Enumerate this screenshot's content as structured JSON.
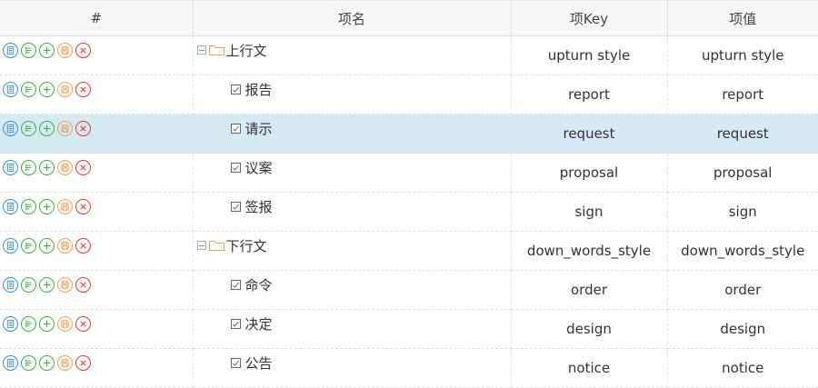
{
  "table": {
    "headers": [
      "#",
      "项名",
      "项Key",
      "项值"
    ],
    "rows": [
      {
        "level": "parent",
        "name": "上行文",
        "key": "upturn style",
        "value": "upturn style",
        "selected": false
      },
      {
        "level": "child",
        "name": "报告",
        "key": "report",
        "value": "report",
        "selected": false
      },
      {
        "level": "child",
        "name": "请示",
        "key": "request",
        "value": "request",
        "selected": true
      },
      {
        "level": "child",
        "name": "议案",
        "key": "proposal",
        "value": "proposal",
        "selected": false
      },
      {
        "level": "child",
        "name": "签报",
        "key": "sign",
        "value": "sign",
        "selected": false
      },
      {
        "level": "parent",
        "name": "下行文",
        "key": "down_words_style",
        "value": "down_words_style",
        "selected": false
      },
      {
        "level": "child",
        "name": "命令",
        "key": "order",
        "value": "order",
        "selected": false
      },
      {
        "level": "child",
        "name": "决定",
        "key": "design",
        "value": "design",
        "selected": false
      },
      {
        "level": "child",
        "name": "公告",
        "key": "notice",
        "value": "notice",
        "selected": false
      }
    ]
  },
  "row_actions": [
    {
      "icon": "view-detail-icon",
      "color": "#3a8fd1"
    },
    {
      "icon": "edit-list-icon",
      "color": "#3fae49"
    },
    {
      "icon": "add-icon",
      "color": "#3fae49"
    },
    {
      "icon": "save-icon",
      "color": "#f0a050"
    },
    {
      "icon": "delete-icon",
      "color": "#e53935"
    }
  ],
  "colors": {
    "selected_row": "#d6eaf5",
    "header_bg": "#f7f7f7"
  }
}
